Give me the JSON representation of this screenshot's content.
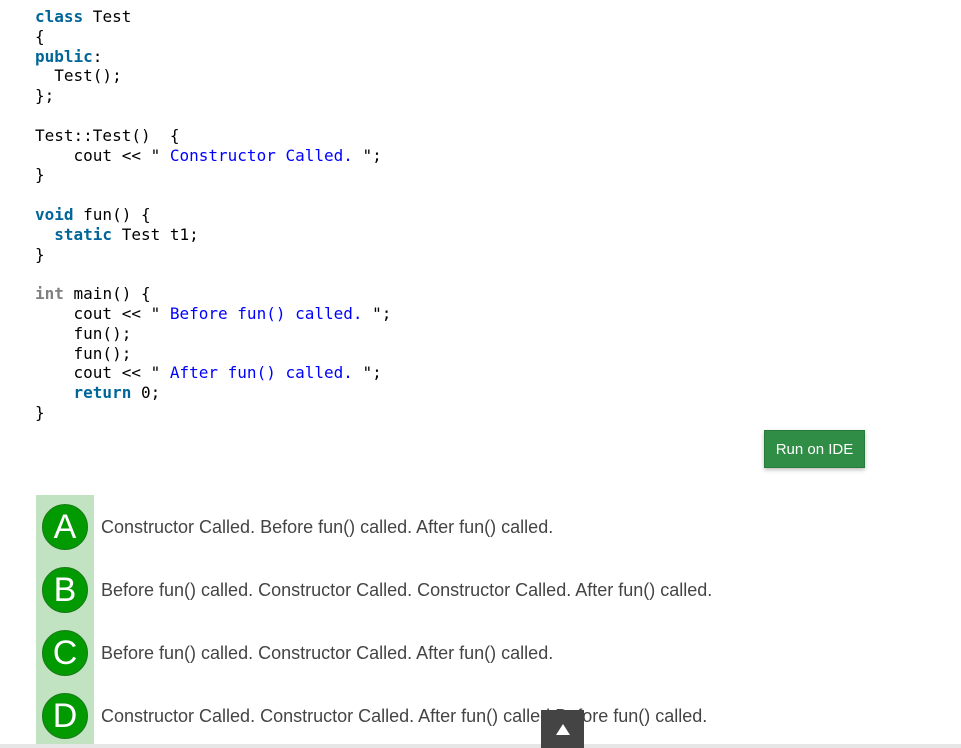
{
  "code": {
    "lines": [
      [
        {
          "t": "keyword",
          "v": "class"
        },
        {
          "t": "plain",
          "v": " Test"
        }
      ],
      [
        {
          "t": "plain",
          "v": "{"
        }
      ],
      [
        {
          "t": "keyword",
          "v": "public"
        },
        {
          "t": "plain",
          "v": ":"
        }
      ],
      [
        {
          "t": "plain",
          "v": "  Test();"
        }
      ],
      [
        {
          "t": "plain",
          "v": "};"
        }
      ],
      [],
      [
        {
          "t": "plain",
          "v": "Test::Test()  {"
        }
      ],
      [
        {
          "t": "plain",
          "v": "    cout << \""
        },
        {
          "t": "string",
          "v": " Constructor Called. "
        },
        {
          "t": "plain",
          "v": "\";"
        }
      ],
      [
        {
          "t": "plain",
          "v": "}"
        }
      ],
      [],
      [
        {
          "t": "keyword",
          "v": "void"
        },
        {
          "t": "plain",
          "v": " fun() {"
        }
      ],
      [
        {
          "t": "plain",
          "v": "  "
        },
        {
          "t": "keyword",
          "v": "static"
        },
        {
          "t": "plain",
          "v": " Test t1;"
        }
      ],
      [
        {
          "t": "plain",
          "v": "}"
        }
      ],
      [],
      [
        {
          "t": "type-gray",
          "v": "int"
        },
        {
          "t": "plain",
          "v": " main() {"
        }
      ],
      [
        {
          "t": "plain",
          "v": "    cout << \""
        },
        {
          "t": "string",
          "v": " Before fun() called. "
        },
        {
          "t": "plain",
          "v": "\";"
        }
      ],
      [
        {
          "t": "plain",
          "v": "    fun();"
        }
      ],
      [
        {
          "t": "plain",
          "v": "    fun();"
        }
      ],
      [
        {
          "t": "plain",
          "v": "    cout << \""
        },
        {
          "t": "string",
          "v": " After fun() called. "
        },
        {
          "t": "plain",
          "v": "\";"
        }
      ],
      [
        {
          "t": "plain",
          "v": "    "
        },
        {
          "t": "keyword",
          "v": "return"
        },
        {
          "t": "plain",
          "v": " 0;"
        }
      ],
      [
        {
          "t": "plain",
          "v": "}"
        }
      ]
    ]
  },
  "run_button": {
    "label": "Run on IDE"
  },
  "options": [
    {
      "letter": "A",
      "text": "Constructor Called. Before fun() called. After fun() called."
    },
    {
      "letter": "B",
      "text": "Before fun() called. Constructor Called. Constructor Called. After fun() called."
    },
    {
      "letter": "C",
      "text": "Before fun() called. Constructor Called. After fun() called."
    },
    {
      "letter": "D",
      "text": "Constructor Called. Constructor Called. After fun() called.Before fun() called."
    }
  ],
  "scroll_top": {
    "icon": "arrow-up-icon"
  },
  "colors": {
    "run_button_bg": "#2f8d46",
    "option_circle": "#019a01",
    "option_strip": "#c1e3c1",
    "code_keyword": "#006699",
    "code_string": "#0000ff"
  }
}
